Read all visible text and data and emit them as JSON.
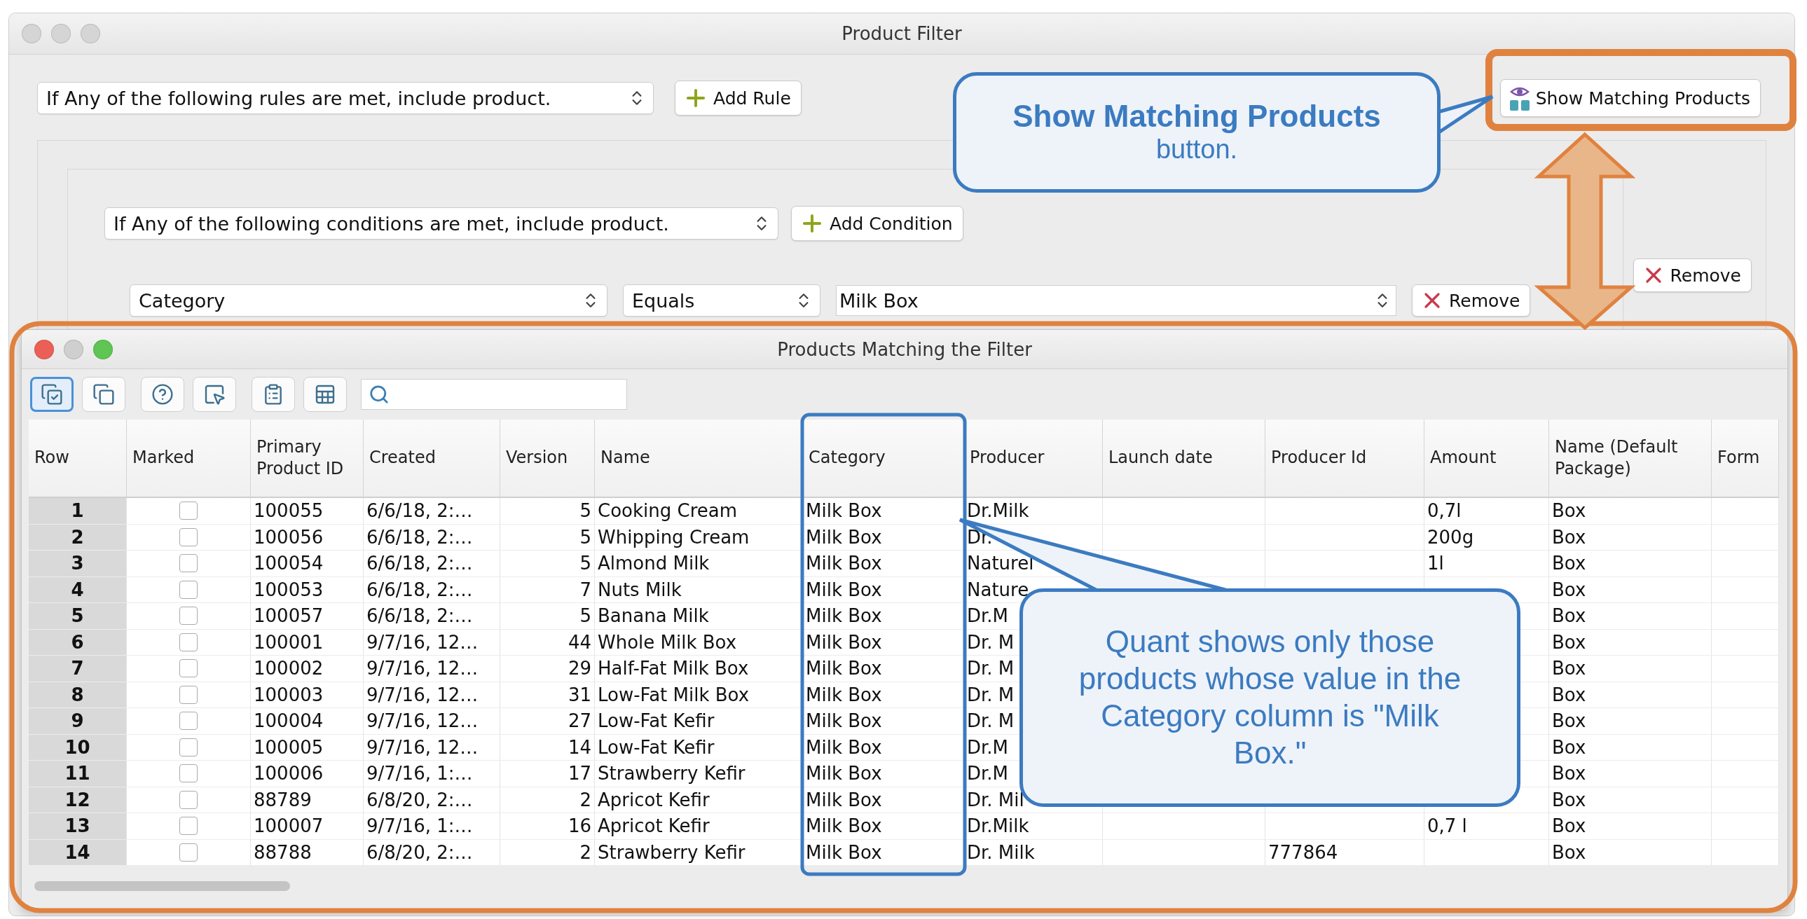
{
  "window": {
    "title": "Product Filter"
  },
  "rule_bar": {
    "mode": "If Any of the following rules are met, include product.",
    "add_button": "Add Rule",
    "show_button": "Show Matching Products"
  },
  "rule": {
    "mode": "If Any of the following conditions are met, include product.",
    "add_button": "Add Condition",
    "remove_button": "Remove"
  },
  "condition": {
    "field": "Category",
    "operator": "Equals",
    "value": "Milk Box",
    "remove_button": "Remove"
  },
  "results_window": {
    "title": "Products Matching the Filter",
    "toolbar": [
      {
        "kind": "mark",
        "selected": true
      },
      {
        "kind": "copy",
        "selected": false
      },
      {
        "kind": "help",
        "selected": false
      },
      {
        "kind": "pointer",
        "selected": false
      },
      {
        "kind": "list",
        "selected": false
      },
      {
        "kind": "sheet",
        "selected": false
      }
    ],
    "table": {
      "columns": [
        "Row",
        "Marked",
        "Primary Product ID",
        "Created",
        "Version",
        "Name",
        "Category",
        "Producer",
        "Launch date",
        "Producer Id",
        "Amount",
        "Name (Default Package)",
        "Form"
      ],
      "rows": [
        {
          "row": "1",
          "marked": false,
          "id": "100055",
          "created": "6/6/18, 2:…",
          "version": "5",
          "name": "Cooking Cream",
          "category": "Milk Box",
          "producer": "Dr.Milk",
          "amount": "0,7l",
          "package": "Box"
        },
        {
          "row": "2",
          "marked": false,
          "id": "100056",
          "created": "6/6/18, 2:…",
          "version": "5",
          "name": "Whipping Cream",
          "category": "Milk Box",
          "producer": "Dr.",
          "amount": "200g",
          "package": "Box"
        },
        {
          "row": "3",
          "marked": false,
          "id": "100054",
          "created": "6/6/18, 2:…",
          "version": "5",
          "name": "Almond Milk",
          "category": "Milk Box",
          "producer": "Naturel",
          "amount": "1l",
          "package": "Box"
        },
        {
          "row": "4",
          "marked": false,
          "id": "100053",
          "created": "6/6/18, 2:…",
          "version": "7",
          "name": "Nuts Milk",
          "category": "Milk Box",
          "producer": "Nature",
          "package": "Box"
        },
        {
          "row": "5",
          "marked": false,
          "id": "100057",
          "created": "6/6/18, 2:…",
          "version": "5",
          "name": "Banana Milk",
          "category": "Milk Box",
          "producer": "Dr.M",
          "package": "Box"
        },
        {
          "row": "6",
          "marked": false,
          "id": "100001",
          "created": "9/7/16, 12…",
          "version": "44",
          "name": "Whole Milk Box",
          "category": "Milk Box",
          "producer": "Dr. M",
          "package": "Box"
        },
        {
          "row": "7",
          "marked": false,
          "id": "100002",
          "created": "9/7/16, 12…",
          "version": "29",
          "name": "Half-Fat Milk Box",
          "category": "Milk Box",
          "producer": "Dr. M",
          "package": "Box"
        },
        {
          "row": "8",
          "marked": false,
          "id": "100003",
          "created": "9/7/16, 12…",
          "version": "31",
          "name": "Low-Fat Milk Box",
          "category": "Milk Box",
          "producer": "Dr. M",
          "package": "Box"
        },
        {
          "row": "9",
          "marked": false,
          "id": "100004",
          "created": "9/7/16, 12…",
          "version": "27",
          "name": "Low-Fat Kefir",
          "category": "Milk Box",
          "producer": "Dr. M",
          "package": "Box"
        },
        {
          "row": "10",
          "marked": false,
          "id": "100005",
          "created": "9/7/16, 12…",
          "version": "14",
          "name": "Low-Fat Kefir",
          "category": "Milk Box",
          "producer": "Dr.M",
          "package": "Box"
        },
        {
          "row": "11",
          "marked": false,
          "id": "100006",
          "created": "9/7/16, 1:…",
          "version": "17",
          "name": "Strawberry Kefir",
          "category": "Milk Box",
          "producer": "Dr.M",
          "package": "Box"
        },
        {
          "row": "12",
          "marked": false,
          "id": "88789",
          "created": "6/8/20, 2:…",
          "version": "2",
          "name": "Apricot Kefir",
          "category": "Milk Box",
          "producer": "Dr. Mil",
          "package": "Box"
        },
        {
          "row": "13",
          "marked": false,
          "id": "100007",
          "created": "9/7/16, 1:…",
          "version": "16",
          "name": "Apricot Kefir",
          "category": "Milk Box",
          "producer": "Dr.Milk",
          "amount": "0,7 l",
          "package": "Box"
        },
        {
          "row": "14",
          "marked": false,
          "id": "88788",
          "created": "6/8/20, 2:…",
          "version": "2",
          "name": "Strawberry Kefir",
          "category": "Milk Box",
          "producer": "Dr. Milk",
          "producer_id": "777864",
          "package": "Box"
        }
      ]
    }
  },
  "annotations": {
    "button_callout": {
      "title": "Show Matching Products",
      "text": "button."
    },
    "table_callout": {
      "text": "Quant shows only those products whose value in the Category column is \"Milk Box.\""
    }
  }
}
